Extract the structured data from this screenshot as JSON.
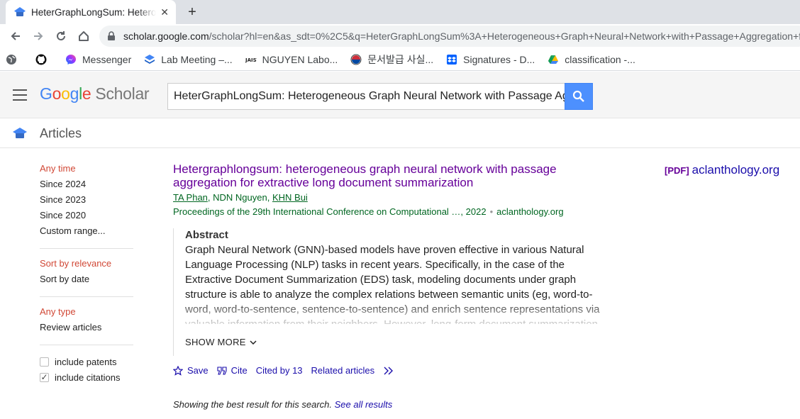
{
  "browser": {
    "tab_title": "HeterGraphLongSum: Heterogeneous Graph Neural Network",
    "tab_close": "✕",
    "new_tab": "+",
    "url_host": "scholar.google.com",
    "url_path": "/scholar?hl=en&as_sdt=0%2C5&q=HeterGraphLongSum%3A+Heterogeneous+Graph+Neural+Network+with+Passage+Aggregation+f"
  },
  "bookmarks": [
    {
      "label": "",
      "icon": "globe-icon"
    },
    {
      "label": "",
      "icon": "github-icon"
    },
    {
      "label": "Messenger",
      "icon": "messenger-icon"
    },
    {
      "label": "Lab Meeting –...",
      "icon": "layers-icon"
    },
    {
      "label": "NGUYEN Labo...",
      "icon": "jaist-icon"
    },
    {
      "label": "문서발급 사실...",
      "icon": "korea-icon"
    },
    {
      "label": "Signatures - D...",
      "icon": "dropbox-icon"
    },
    {
      "label": "classification -...",
      "icon": "drive-icon"
    }
  ],
  "scholar": {
    "logo_letters": [
      "G",
      "o",
      "o",
      "g",
      "l",
      "e"
    ],
    "logo_suffix": "Scholar",
    "search_value": "HeterGraphLongSum: Heterogeneous Graph Neural Network with Passage Aggregation",
    "section_label": "Articles"
  },
  "filters": {
    "time": [
      "Any time",
      "Since 2024",
      "Since 2023",
      "Since 2020",
      "Custom range..."
    ],
    "sort": [
      "Sort by relevance",
      "Sort by date"
    ],
    "type": [
      "Any type",
      "Review articles"
    ],
    "include_patents": {
      "label": "include patents",
      "checked": false
    },
    "include_citations": {
      "label": "include citations",
      "checked": true
    }
  },
  "result": {
    "title_line1": "Hetergraphlongsum: heterogeneous graph neural network with passage",
    "title_line2": "aggregation for extractive long document summarization",
    "authors": [
      {
        "name": "TA Phan",
        "linked": true
      },
      {
        "name": "NDN Nguyen",
        "linked": false
      },
      {
        "name": "KHN Bui",
        "linked": true
      }
    ],
    "author_sep": ", ",
    "venue": "Proceedings of the 29th International Conference on Computational …, 2022",
    "venue_sep": "•",
    "source": "aclanthology.org",
    "abstract_heading": "Abstract",
    "abstract_lines": [
      "Graph Neural Network (GNN)-based models have proven effective in various Natural",
      "Language Processing (NLP) tasks in recent years. Specifically, in the case of the",
      "Extractive Document Summarization (EDS) task, modeling documents under graph",
      "structure is able to analyze the complex relations between semantic units (eg, word-to-",
      "word, word-to-sentence, sentence-to-sentence) and enrich sentence representations via",
      "valuable information from their neighbors. However, long-form document summarization"
    ],
    "show_more": "SHOW MORE",
    "actions": {
      "save": "Save",
      "cite": "Cite",
      "cited_by": "Cited by 13",
      "related": "Related articles"
    },
    "pdf_tag": "[PDF]",
    "pdf_source": "aclanthology.org"
  },
  "footer": {
    "best_text": "Showing the best result for this search.",
    "see_all": "See all results"
  }
}
